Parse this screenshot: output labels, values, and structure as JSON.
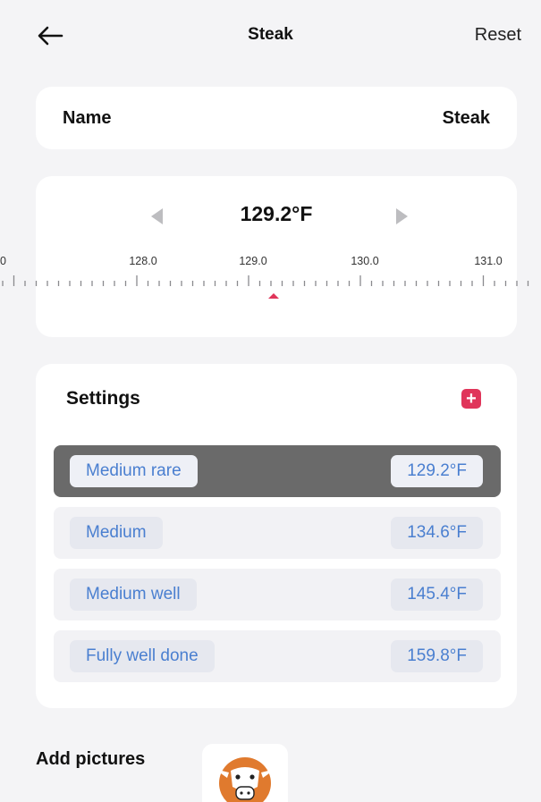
{
  "header": {
    "title": "Steak",
    "reset_label": "Reset",
    "back_icon": "arrow-left-icon"
  },
  "name_card": {
    "label": "Name",
    "value": "Steak"
  },
  "temperature": {
    "value_display": "129.2°F",
    "current_value": 129.2,
    "ticks": [
      "0",
      "128.0",
      "129.0",
      "130.0",
      "131.0"
    ],
    "prev_icon": "triangle-left-icon",
    "next_icon": "triangle-right-icon",
    "indicator_color": "#e0355a"
  },
  "settings": {
    "title": "Settings",
    "add_icon": "plus-icon",
    "items": [
      {
        "name": "Medium rare",
        "temp": "129.2°F",
        "selected": true
      },
      {
        "name": "Medium",
        "temp": "134.6°F",
        "selected": false
      },
      {
        "name": "Medium well",
        "temp": "145.4°F",
        "selected": false
      },
      {
        "name": "Fully well done",
        "temp": "159.8°F",
        "selected": false
      }
    ]
  },
  "pictures": {
    "label": "Add pictures",
    "thumb_icon": "cow-icon"
  },
  "colors": {
    "accent": "#e0355a",
    "pill_text": "#4a7fd0",
    "selected_row": "#6a6a6a",
    "cow_orange": "#e07a2e"
  }
}
